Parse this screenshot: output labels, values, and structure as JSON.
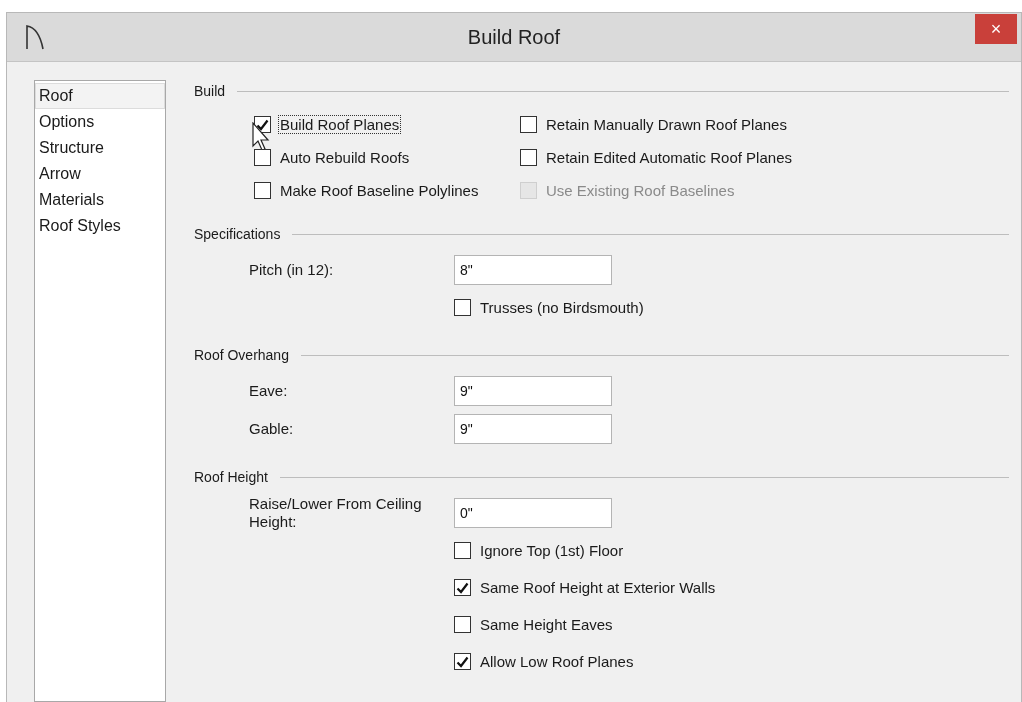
{
  "window": {
    "title": "Build Roof",
    "close": "×"
  },
  "sidebar": {
    "items": [
      {
        "label": "Roof",
        "selected": true
      },
      {
        "label": "Options",
        "selected": false
      },
      {
        "label": "Structure",
        "selected": false
      },
      {
        "label": "Arrow",
        "selected": false
      },
      {
        "label": "Materials",
        "selected": false
      },
      {
        "label": "Roof Styles",
        "selected": false
      }
    ]
  },
  "sections": [
    {
      "title": "Build",
      "kind": "grid",
      "items": [
        {
          "label": "Build Roof Planes",
          "checked": true,
          "disabled": false,
          "focused": true
        },
        {
          "label": "Retain Manually Drawn Roof Planes",
          "checked": false,
          "disabled": false,
          "focused": false
        },
        {
          "label": "Auto Rebuild Roofs",
          "checked": false,
          "disabled": false,
          "focused": false
        },
        {
          "label": "Retain Edited Automatic Roof Planes",
          "checked": false,
          "disabled": false,
          "focused": false
        },
        {
          "label": "Make Roof Baseline Polylines",
          "checked": false,
          "disabled": false,
          "focused": false
        },
        {
          "label": "Use Existing Roof Baselines",
          "checked": false,
          "disabled": true,
          "focused": false
        }
      ]
    },
    {
      "title": "Specifications",
      "kind": "form",
      "rows": [
        {
          "kind": "field",
          "label": "Pitch (in 12):",
          "value": "8\""
        },
        {
          "kind": "checkbox",
          "label": "Trusses (no Birdsmouth)",
          "checked": false
        }
      ]
    },
    {
      "title": "Roof Overhang",
      "kind": "form",
      "rows": [
        {
          "kind": "field",
          "label": "Eave:",
          "value": "9\""
        },
        {
          "kind": "field",
          "label": "Gable:",
          "value": "9\""
        }
      ]
    },
    {
      "title": "Roof Height",
      "kind": "form",
      "rows": [
        {
          "kind": "field",
          "label": "Raise/Lower From Ceiling Height:",
          "value": "0\""
        },
        {
          "kind": "checkbox",
          "label": "Ignore Top (1st) Floor",
          "checked": false
        },
        {
          "kind": "checkbox",
          "label": "Same Roof Height at Exterior Walls",
          "checked": true
        },
        {
          "kind": "checkbox",
          "label": "Same Height Eaves",
          "checked": false
        },
        {
          "kind": "checkbox",
          "label": "Allow Low Roof Planes",
          "checked": true
        }
      ]
    }
  ]
}
